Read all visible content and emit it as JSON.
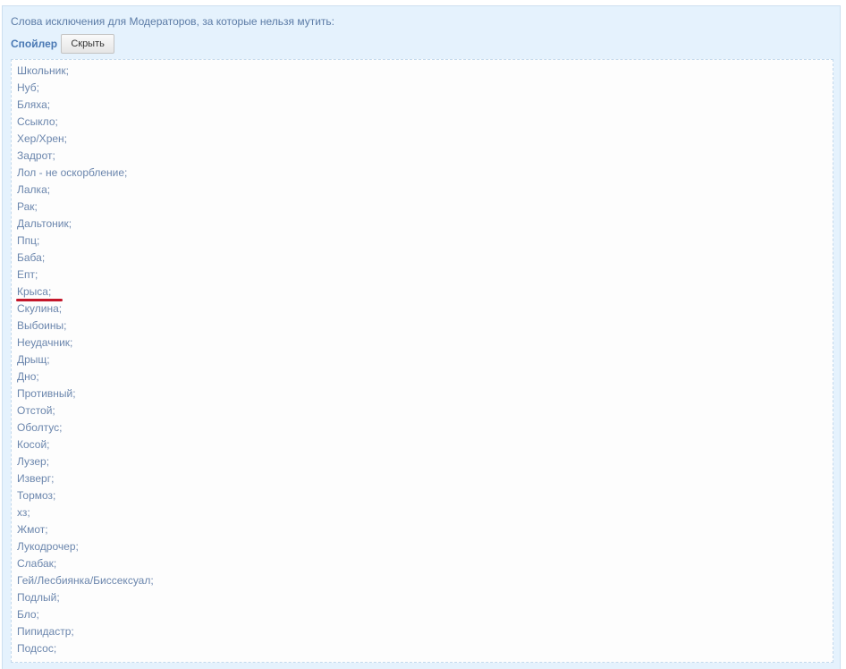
{
  "intro_text": "Слова исключения для Модераторов, за которые нельзя мутить:",
  "spoiler": {
    "title": "Спойлер",
    "toggle_label": "Скрыть"
  },
  "words": [
    "Школьник;",
    "Нуб;",
    "Бляха;",
    "Ссыкло;",
    "Хер/Хрен;",
    "Задрот;",
    "Лол - не оскорбление;",
    "Лалка;",
    "Рак;",
    "Дальтоник;",
    "Ппц;",
    "Баба;",
    "Епт;",
    "Крыса;",
    "Скулина;",
    "Выбоины;",
    "Неудачник;",
    "Дрыщ;",
    "Дно;",
    "Противный;",
    "Отстой;",
    "Оболтус;",
    "Косой;",
    "Лузер;",
    "Изверг;",
    "Тормоз;",
    "хз;",
    "Жмот;",
    "Лукодрочер;",
    "Слабак;",
    "Гей/Лесбиянка/Биссексуал;",
    "Подлый;",
    "Бло;",
    "Пипидастр;",
    "Подсос;"
  ],
  "colors": {
    "panel_background": "#e5f2fd",
    "text": "#6b86ad",
    "title": "#4a79b4",
    "annotation_underline": "#c4162a"
  }
}
